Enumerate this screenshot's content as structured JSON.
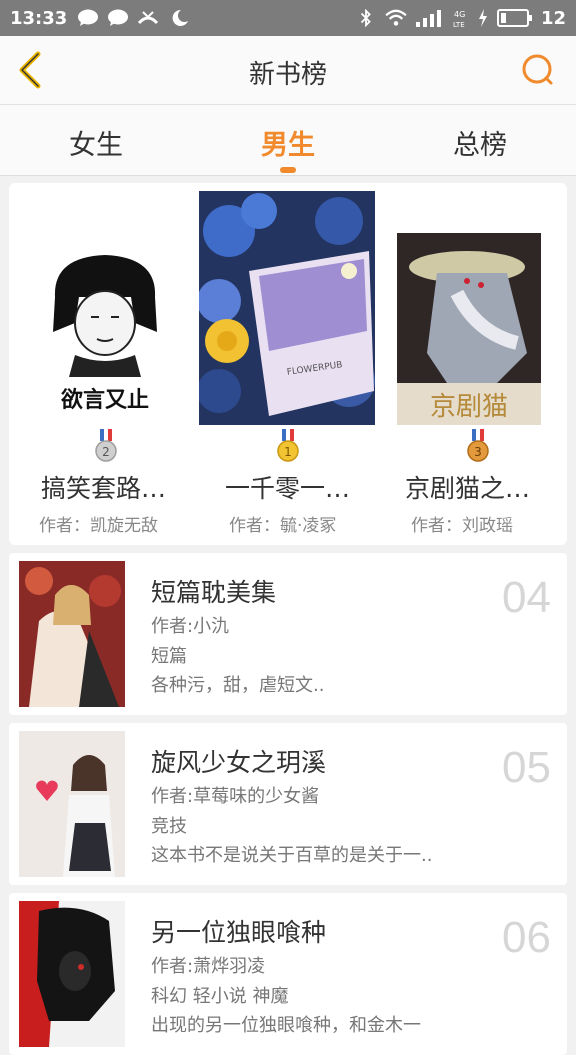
{
  "status_bar": {
    "time": "13:33",
    "network": "4G LTE",
    "battery": "12"
  },
  "header": {
    "title": "新书榜"
  },
  "tabs": [
    {
      "label": "女生",
      "active": false
    },
    {
      "label": "男生",
      "active": true
    },
    {
      "label": "总榜",
      "active": false
    }
  ],
  "podium": [
    {
      "rank": "2",
      "title": "搞笑套路…",
      "author": "作者：凯旋无敌",
      "cover_text": "欲言又止"
    },
    {
      "rank": "1",
      "title": "一千零一…",
      "author": "作者：毓·凌冢",
      "cover_text": "FLOWERPUB"
    },
    {
      "rank": "3",
      "title": "京剧猫之…",
      "author": "作者：刘政瑶",
      "cover_text": "京剧猫"
    }
  ],
  "list": [
    {
      "rank": "04",
      "title": "短篇耽美集",
      "author": "作者:小氿",
      "tags": "短篇",
      "desc": "各种污，甜，虐短文.."
    },
    {
      "rank": "05",
      "title": "旋风少女之玥溪",
      "author": "作者:草莓味的少女酱",
      "tags": "竞技",
      "desc": "这本书不是说关于百草的是关于一.."
    },
    {
      "rank": "06",
      "title": "另一位独眼喰种",
      "author": "作者:萧烨羽凌",
      "tags": "科幻  轻小说  神魔",
      "desc": "出现的另一位独眼喰种，和金木一"
    }
  ],
  "colors": {
    "accent": "#f08a2c",
    "back_arrow": "#e8b400",
    "rank_number": "#d6d6d6"
  }
}
